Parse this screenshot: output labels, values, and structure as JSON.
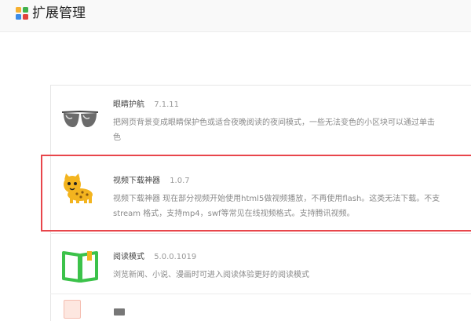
{
  "header": {
    "title": "扩展管理",
    "logo_icon": "grid-apps-icon",
    "logo_colors": [
      "#f6b031",
      "#42b14c",
      "#3d8ce8",
      "#e2433b"
    ]
  },
  "extensions": [
    {
      "name": "眼睛护航",
      "version": "7.1.11",
      "icon": "sunglasses-icon",
      "description_lines": [
        "把网页背景变成眼睛保护色或适合夜晚阅读的夜间模式，一些无法变色的小区块可以通过单击",
        "色"
      ]
    },
    {
      "name": "视频下载神器",
      "version": "1.0.7",
      "icon": "cheetah-icon",
      "highlighted": true,
      "description_lines": [
        "视频下载神器 现在部分视频开始使用html5做视频播放，不再使用flash。这类无法下载。不支",
        "stream 格式，支持mp4，swf等常见在线视频格式。支持腾讯视频。"
      ]
    },
    {
      "name": "阅读模式",
      "version": "5.0.0.1019",
      "icon": "open-book-icon",
      "description_lines": [
        "浏览新闻、小说、漫画时可进入阅读体验更好的阅读模式"
      ]
    }
  ],
  "colors": {
    "highlight": "#e8464b",
    "book_green": "#3cc24a",
    "cheetah_yellow": "#f3b41f"
  }
}
